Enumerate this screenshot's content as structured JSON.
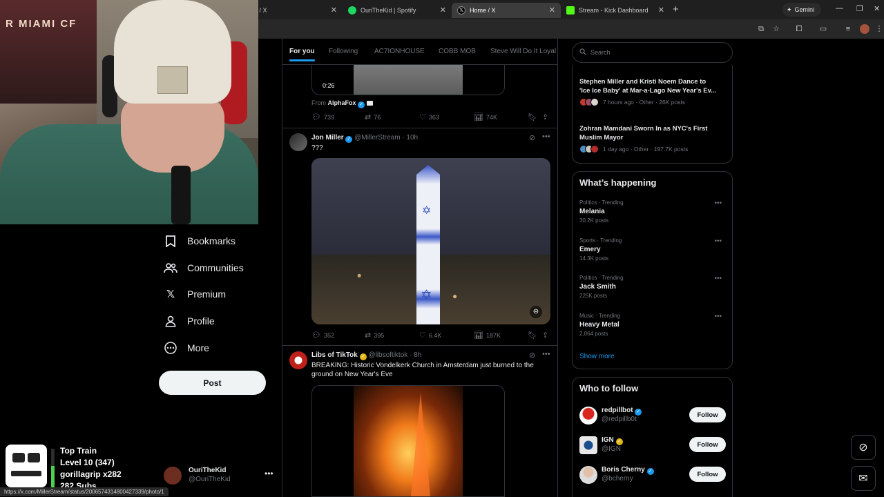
{
  "browser": {
    "tabs": [
      {
        "title": "e / X",
        "favicon_color": "#000000"
      },
      {
        "title": "OuriTheKid | Spotify",
        "favicon_color": "#1ed760"
      },
      {
        "title": "Home / X",
        "favicon_color": "#000000"
      },
      {
        "title": "Stream - Kick Dashboard",
        "favicon_color": "#53fc18"
      }
    ],
    "active_tab_index": 2,
    "gemini_label": "Gemini",
    "status_url": "https://x.com/MillerStream/status/2006574314800427339/photo/1"
  },
  "webcam": {
    "poster_text": "R MIAMI CF"
  },
  "left_nav": {
    "items": [
      {
        "label": "Bookmarks",
        "icon": "bookmark-icon"
      },
      {
        "label": "Communities",
        "icon": "communities-icon"
      },
      {
        "label": "Premium",
        "icon": "x-logo-icon"
      },
      {
        "label": "Profile",
        "icon": "profile-icon"
      },
      {
        "label": "More",
        "icon": "more-circle-icon"
      }
    ],
    "post_label": "Post",
    "account": {
      "name": "OuriTheKid",
      "handle": "@OuriTheKid"
    }
  },
  "train_widget": {
    "title": "Top Train",
    "level": "Level 10  (347)",
    "top_user": "gorillagrip x282",
    "subs": "282 Subs",
    "progress_fraction": 0.55
  },
  "timeline": {
    "tabs": [
      "For you",
      "Following",
      "AC7IONHOUSE",
      "COBB MOB",
      "Steve Will Do It Loyal"
    ],
    "active_tab": "For you",
    "tweet0": {
      "video_duration": "0:26",
      "from_label": "From",
      "from_name": "AlphaFox",
      "stats": {
        "replies": "739",
        "reposts": "76",
        "likes": "363",
        "views": "74K"
      }
    },
    "tweet1": {
      "name": "Jon Miller",
      "handle": "@MillerStream",
      "time": "· 10h",
      "text": "???",
      "stats": {
        "replies": "352",
        "reposts": "395",
        "likes": "6.4K",
        "views": "187K"
      }
    },
    "tweet2": {
      "name": "Libs of TikTok",
      "handle": "@libsoftiktok",
      "time": "· 8h",
      "text_line1": "BREAKING: Historic Vondelkerk Church in Amsterdam just burned to the",
      "text_line2": "ground on New Year's Eve"
    }
  },
  "right_sidebar": {
    "search_placeholder": "Search",
    "news": [
      {
        "title_l1": "Stephen Miller and Kristi Noem Dance to",
        "title_l2": "'Ice Ice Baby' at Mar-a-Lago New Year's Ev...",
        "meta": "7 hours ago · Other · 26K posts"
      },
      {
        "title_l1": "Zohran Mamdani Sworn In as NYC's First",
        "title_l2": "Muslim Mayor",
        "meta": "1 day ago · Other · 197.7K posts"
      }
    ],
    "whats_happening_title": "What’s happening",
    "trends": [
      {
        "category": "Politics · Trending",
        "name": "Melania",
        "posts": "30.2K posts"
      },
      {
        "category": "Sports · Trending",
        "name": "Emery",
        "posts": "14.3K posts"
      },
      {
        "category": "Politics · Trending",
        "name": "Jack Smith",
        "posts": "225K posts"
      },
      {
        "category": "Music · Trending",
        "name": "Heavy Metal",
        "posts": "2,064 posts"
      }
    ],
    "show_more": "Show more",
    "who_to_follow_title": "Who to follow",
    "follow_suggestions": [
      {
        "name": "redpillbot",
        "handle": "@redpillb0t",
        "badge": "blue",
        "button": "Follow"
      },
      {
        "name": "IGN",
        "handle": "@IGN",
        "badge": "gold",
        "button": "Follow"
      },
      {
        "name": "Boris Cherny",
        "handle": "@bcherny",
        "badge": "blue",
        "button": "Follow"
      }
    ]
  },
  "colors": {
    "accent": "#1d9bf0",
    "background": "#000000",
    "border": "#2f3336",
    "muted_text": "#71767b"
  }
}
